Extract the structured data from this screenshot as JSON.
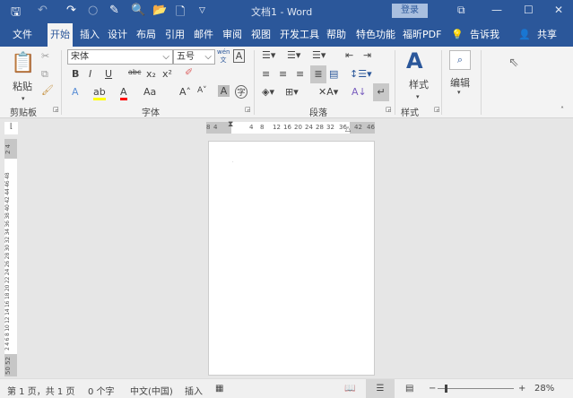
{
  "titlebar": {
    "title": "文档1  -  Word",
    "login": "登录"
  },
  "tabs": [
    "文件",
    "开始",
    "插入",
    "设计",
    "布局",
    "引用",
    "邮件",
    "审阅",
    "视图",
    "开发工具",
    "帮助",
    "特色功能",
    "福昕PDF",
    "告诉我",
    "共享"
  ],
  "ribbon": {
    "clipboard": {
      "label": "剪贴板",
      "paste": "粘贴"
    },
    "font": {
      "label": "字体",
      "font_name": "宋体",
      "font_size": "五号",
      "phonetic": "wén 文"
    },
    "paragraph": {
      "label": "段落"
    },
    "styles": {
      "label": "样式",
      "button": "样式"
    },
    "editing": {
      "button": "编辑"
    }
  },
  "ruler": {
    "h_ticks": [
      "8",
      "4",
      "4",
      "8",
      "12",
      "16",
      "20",
      "24",
      "28",
      "32",
      "36",
      "42",
      "46"
    ],
    "v_text_top": "2 4",
    "v_text": "2 4 6 8 10 12 14 16 18 20 22 24 26 28 30 32 34 36 38 40 42 44 46 48",
    "v_text_bottom": "50 52"
  },
  "status": {
    "page": "第 1 页，共 1 页",
    "words": "0 个字",
    "lang": "中文(中国)",
    "mode": "插入",
    "zoom": "28%"
  },
  "colors": {
    "brand": "#2b579a",
    "highlight": "#ffff00",
    "font_color": "#ff0000"
  },
  "zoom_level_percent": 28
}
